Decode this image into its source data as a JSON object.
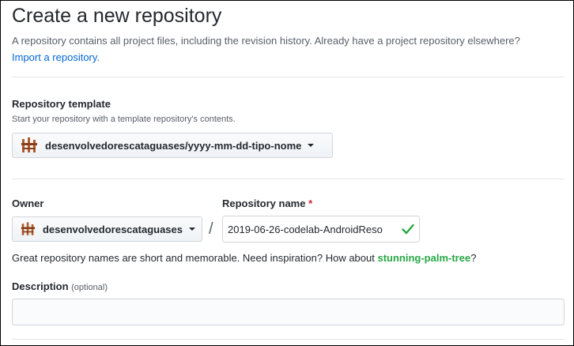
{
  "page": {
    "title": "Create a new repository",
    "subtitle": "A repository contains all project files, including the revision history. Already have a project repository elsewhere?",
    "import_link": "Import a repository."
  },
  "template": {
    "label": "Repository template",
    "note": "Start your repository with a template repository's contents.",
    "selected": "desenvolvedorescataguases/yyyy-mm-dd-tipo-nome"
  },
  "owner": {
    "label": "Owner",
    "selected": "desenvolvedorescataguases"
  },
  "separator": "/",
  "repo_name": {
    "label": "Repository name",
    "required_mark": "*",
    "value": "2019-06-26-codelab-AndroidReso",
    "status_icon": "check-icon"
  },
  "hint": {
    "text": "Great repository names are short and memorable. Need inspiration? How about ",
    "suggestion": "stunning-palm-tree",
    "end": "?"
  },
  "description": {
    "label": "Description",
    "optional": "(optional)",
    "value": ""
  },
  "colors": {
    "accent_green": "#28a745",
    "link_blue": "#0366d6",
    "required_red": "#cb2431",
    "avatar_brown": "#b05a2a"
  }
}
